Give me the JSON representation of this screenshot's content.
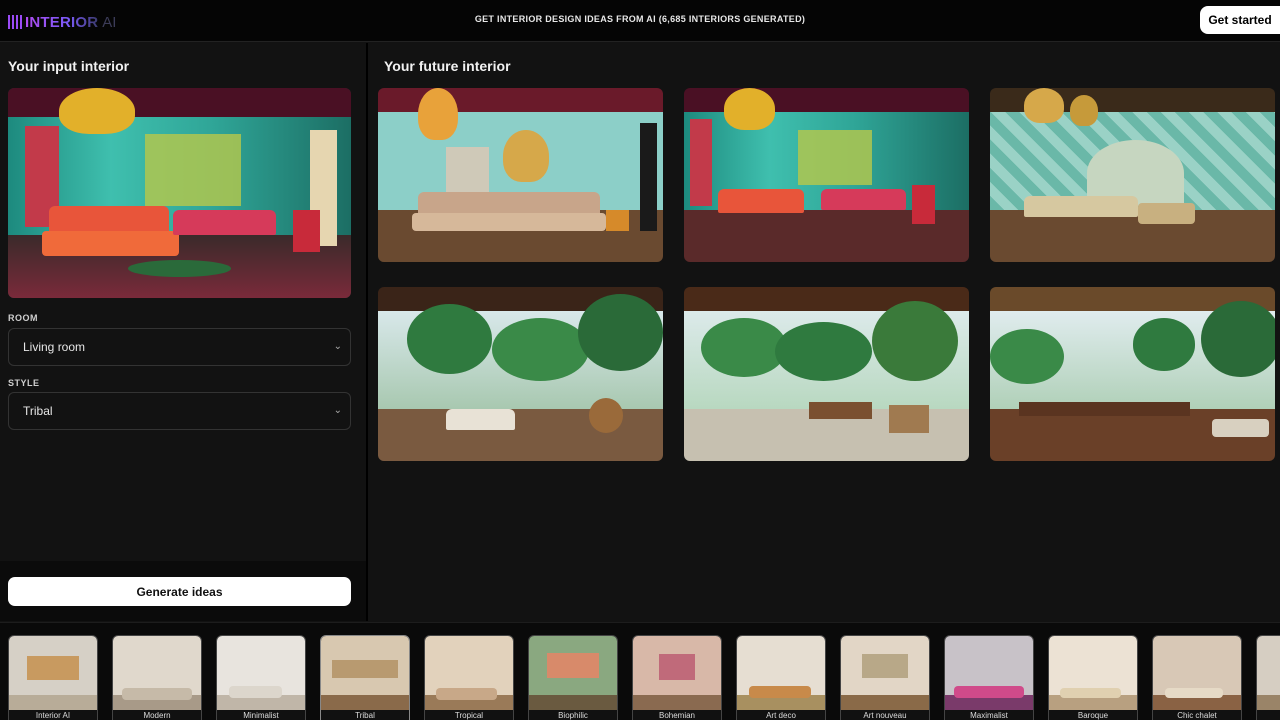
{
  "header": {
    "logo": "INTERIOR",
    "logo_suffix": "AI",
    "tagline": "GET INTERIOR DESIGN IDEAS FROM AI (6,685 INTERIORS GENERATED)",
    "cta_label": "Get started"
  },
  "left": {
    "title": "Your input interior",
    "room_label": "ROOM",
    "room_value": "Living room",
    "style_label": "STYLE",
    "style_value": "Tribal",
    "generate_label": "Generate ideas"
  },
  "right": {
    "title": "Your future interior"
  },
  "colors": {
    "accent": "#9a4bf5",
    "teal": "#3fbfae",
    "maroon": "#5a1a2a",
    "coral": "#e8553a"
  },
  "styles": [
    {
      "name": "Interior AI"
    },
    {
      "name": "Modern"
    },
    {
      "name": "Minimalist"
    },
    {
      "name": "Tribal"
    },
    {
      "name": "Tropical"
    },
    {
      "name": "Biophilic"
    },
    {
      "name": "Bohemian"
    },
    {
      "name": "Art deco"
    },
    {
      "name": "Art nouveau"
    },
    {
      "name": "Maximalist"
    },
    {
      "name": "Baroque"
    },
    {
      "name": "Chic chalet"
    },
    {
      "name": ""
    }
  ]
}
